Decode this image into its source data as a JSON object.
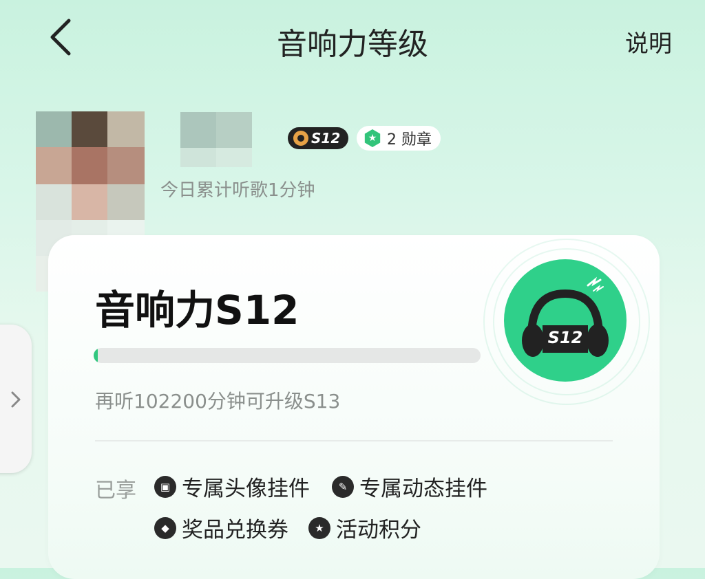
{
  "header": {
    "title": "音响力等级",
    "help_label": "说明"
  },
  "profile": {
    "level_badge": "S12",
    "medal_count_label": "2 勋章",
    "today_listening": "今日累计听歌1分钟"
  },
  "card": {
    "level_title": "音响力S12",
    "progress_fraction": 0.01,
    "next_level_text": "再听102200分钟可升级S13",
    "level_icon_label": "S12",
    "perks_label": "已享",
    "perks": [
      {
        "label": "专属头像挂件",
        "icon": "avatar-pendant-icon"
      },
      {
        "label": "专属动态挂件",
        "icon": "dynamic-pendant-icon"
      },
      {
        "label": "奖品兑换券",
        "icon": "coupon-icon"
      },
      {
        "label": "活动积分",
        "icon": "star-icon"
      }
    ]
  },
  "colors": {
    "accent": "#31c77f",
    "background": "#d9f6e9",
    "dark": "#222222"
  }
}
